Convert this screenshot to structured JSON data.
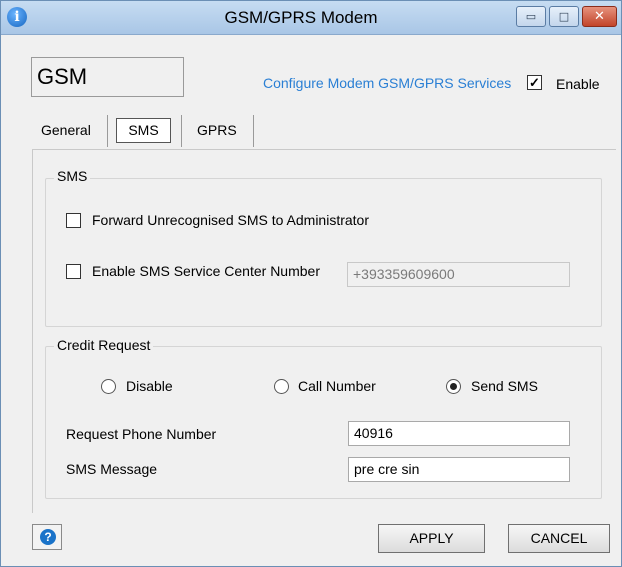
{
  "window": {
    "title": "GSM/GPRS Modem",
    "buttons": {
      "minimize": "▭",
      "maximize": "□",
      "close": "✕"
    }
  },
  "header": {
    "mode_box": "GSM",
    "configure_link": "Configure Modem GSM/GPRS Services",
    "enable_label": "Enable",
    "enable_checked": true
  },
  "tabs": [
    {
      "label": "General",
      "selected": false
    },
    {
      "label": "SMS",
      "selected": true
    },
    {
      "label": "GPRS",
      "selected": false
    }
  ],
  "sms_group": {
    "legend": "SMS",
    "forward_label": "Forward Unrecognised SMS to Administrator",
    "forward_checked": false,
    "service_center_label": "Enable SMS Service Center Number",
    "service_center_checked": false,
    "service_center_value": "+393359609600"
  },
  "credit_group": {
    "legend": "Credit Request",
    "options": [
      {
        "label": "Disable",
        "selected": false
      },
      {
        "label": "Call Number",
        "selected": false
      },
      {
        "label": "Send SMS",
        "selected": true
      }
    ],
    "phone_label": "Request Phone Number",
    "phone_value": "40916",
    "message_label": "SMS Message",
    "message_value": "pre cre sin"
  },
  "footer": {
    "help_icon": "?",
    "apply_label": "APPLY",
    "cancel_label": "CANCEL"
  }
}
